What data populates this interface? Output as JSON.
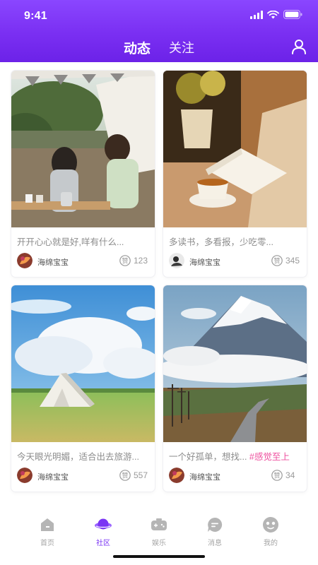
{
  "status_bar": {
    "time": "9:41"
  },
  "nav": {
    "tabs": [
      {
        "label": "动态",
        "active": true
      },
      {
        "label": "关注",
        "active": false
      }
    ],
    "user_icon": "user-icon"
  },
  "posts": [
    {
      "text": "开开心心就是好,咩有什么...",
      "tag": "",
      "author": "海绵宝宝",
      "likes": "123"
    },
    {
      "text": "多读书，多看报，少吃零...",
      "tag": "",
      "author": "海绵宝宝",
      "likes": "345"
    },
    {
      "text": "今天眼光明媚，适合出去旅游...",
      "tag": "",
      "author": "海绵宝宝",
      "likes": "557"
    },
    {
      "text": "一个好孤单，想找... ",
      "tag": "#感觉至上",
      "author": "海绵宝宝",
      "likes": "34"
    }
  ],
  "like_icon_char": "赞",
  "tabbar": {
    "items": [
      {
        "label": "首页",
        "icon": "home-icon",
        "active": false
      },
      {
        "label": "社区",
        "icon": "planet-icon",
        "active": true
      },
      {
        "label": "娱乐",
        "icon": "gamepad-icon",
        "active": false
      },
      {
        "label": "消息",
        "icon": "chat-icon",
        "active": false
      },
      {
        "label": "我的",
        "icon": "profile-face-icon",
        "active": false
      }
    ]
  },
  "colors": {
    "header_gradient_top": "#8a46ff",
    "header_gradient_bottom": "#6c22e8",
    "accent": "#7a34f4",
    "tag_pink": "#ee4f9e",
    "tab_inactive": "#a5a5a5"
  }
}
